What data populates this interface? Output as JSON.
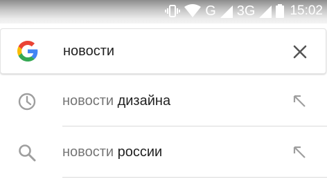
{
  "status_bar": {
    "network_primary": "G",
    "network_secondary": "3G",
    "time": "15:02",
    "icons": [
      "vibrate-icon",
      "wifi-icon",
      "signal-icon",
      "signal-icon",
      "battery-icon"
    ]
  },
  "search": {
    "query": "новости",
    "logo": "google-logo",
    "clear_icon": "close-icon"
  },
  "suggestions": [
    {
      "icon": "history-clock-icon",
      "prefix": "новости",
      "suffix": "дизайна",
      "action_icon": "arrow-up-left-icon"
    },
    {
      "icon": "search-icon",
      "prefix": "новости",
      "suffix": "россии",
      "action_icon": "arrow-up-left-icon"
    }
  ],
  "colors": {
    "google_blue": "#4285F4",
    "google_red": "#EA4335",
    "google_yellow": "#FBBC05",
    "google_green": "#34A853",
    "icon_gray": "#9e9e9e",
    "text_dark": "#212121",
    "text_muted": "#757575"
  }
}
